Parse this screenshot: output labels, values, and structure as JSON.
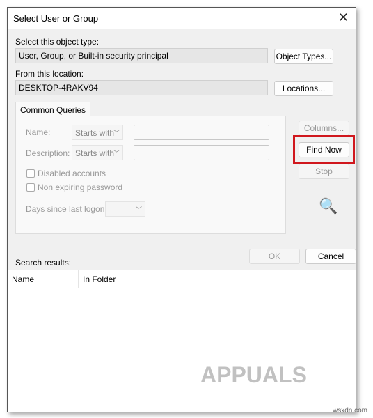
{
  "window": {
    "title": "Select User or Group",
    "close_icon": "close-icon"
  },
  "object_type": {
    "label": "Select this object type:",
    "value": "User, Group, or Built-in security principal",
    "button": "Object Types..."
  },
  "location": {
    "label": "From this location:",
    "value": "DESKTOP-4RAKV94",
    "button": "Locations..."
  },
  "queries": {
    "tab": "Common Queries",
    "name_label": "Name:",
    "name_mode": "Starts with",
    "name_value": "",
    "desc_label": "Description:",
    "desc_mode": "Starts with",
    "desc_value": "",
    "disabled_accounts": "Disabled accounts",
    "non_expiring": "Non expiring password",
    "days_label": "Days since last logon:",
    "days_value": ""
  },
  "side_buttons": {
    "columns": "Columns...",
    "find_now": "Find Now",
    "stop": "Stop",
    "search_icon": "search-folder-icon"
  },
  "highlight_color": "#d0171d",
  "ok": "OK",
  "cancel": "Cancel",
  "results": {
    "label": "Search results:",
    "columns": [
      "Name",
      "In Folder"
    ]
  },
  "watermark": {
    "brand": "APPUALS",
    "site": "wsxdn.com"
  }
}
